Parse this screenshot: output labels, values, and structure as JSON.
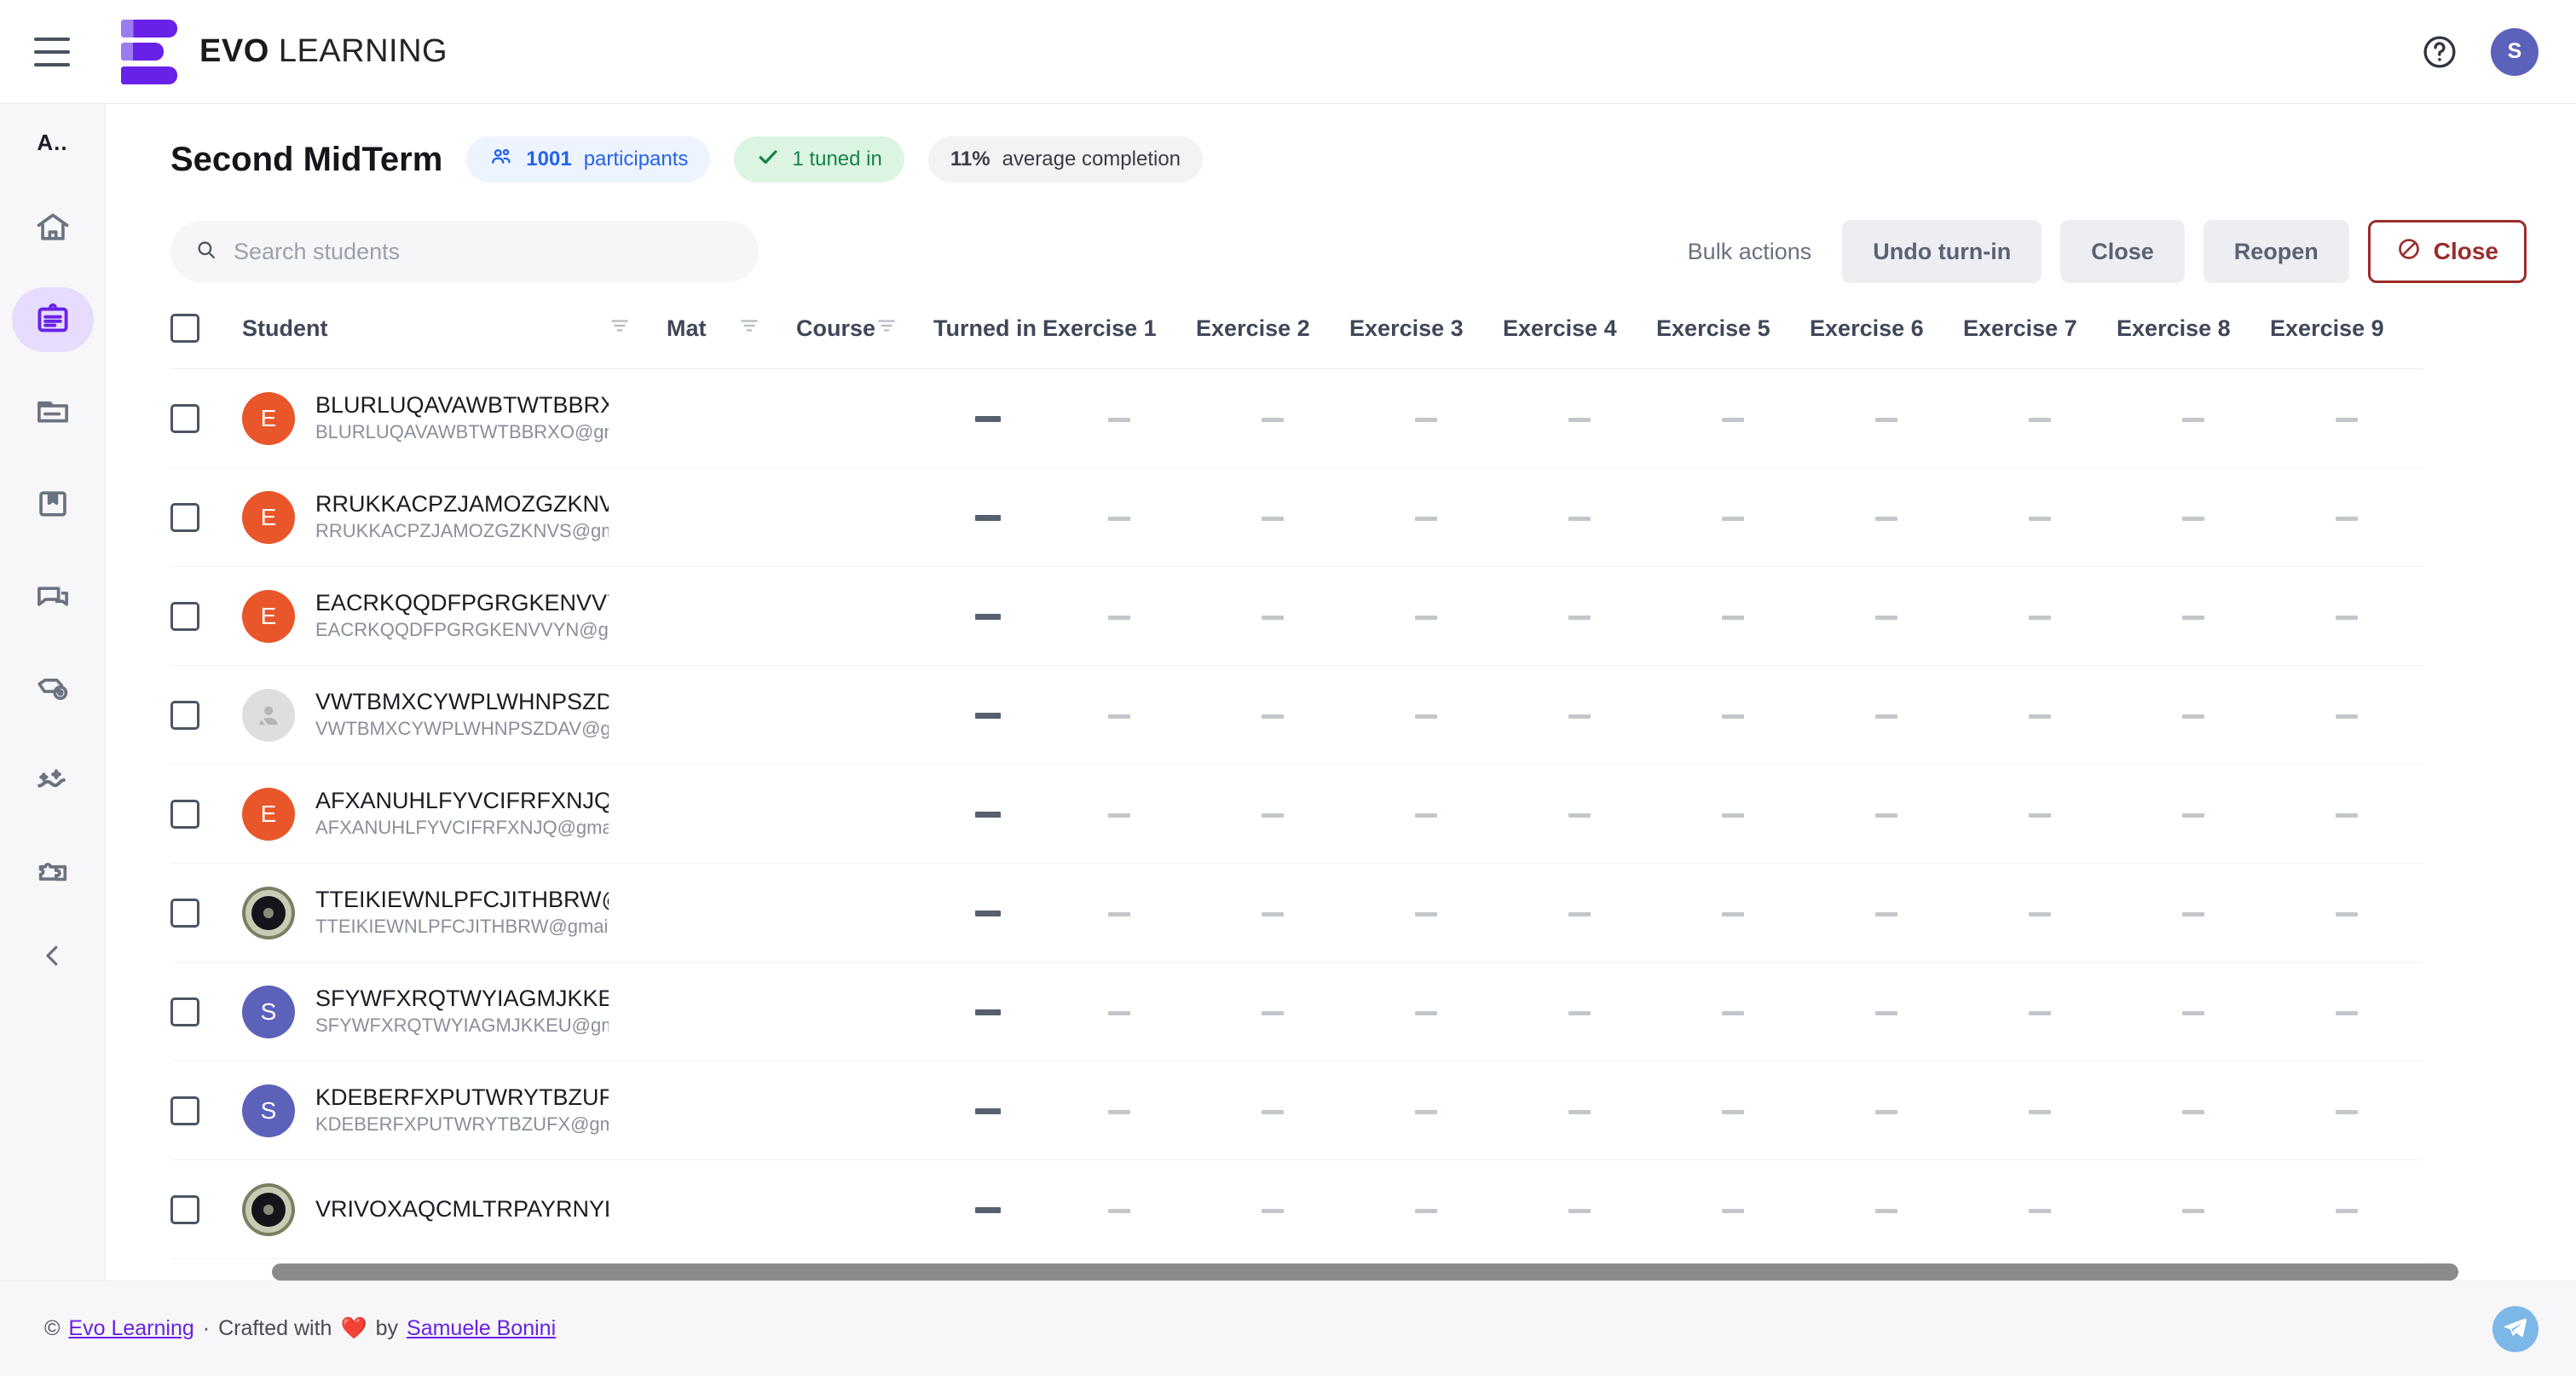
{
  "header": {
    "menu_icon": "hamburger-icon",
    "brand_bold": "EVO",
    "brand_light": "LEARNING",
    "help_icon": "help-circle-icon",
    "avatar_initial": "S"
  },
  "sidebar": {
    "label": "A..",
    "items": [
      {
        "icon": "home-icon",
        "name": "home"
      },
      {
        "icon": "clipboard-icon",
        "name": "assignments",
        "active": true
      },
      {
        "icon": "folder-icon",
        "name": "materials"
      },
      {
        "icon": "book-icon",
        "name": "library"
      },
      {
        "icon": "chat-icon",
        "name": "messages"
      },
      {
        "icon": "tag-eye-icon",
        "name": "tags"
      },
      {
        "icon": "sparkle-line-icon",
        "name": "insights"
      },
      {
        "icon": "puzzle-icon",
        "name": "integrations"
      }
    ],
    "collapse_icon": "chevron-left-icon"
  },
  "page": {
    "title": "Second MidTerm",
    "badges": {
      "participants_count": "1001",
      "participants_label": "participants",
      "participants_icon": "group-icon",
      "tuned_in": "1 tuned in",
      "tuned_in_icon": "check-icon",
      "completion_value": "11%",
      "completion_label": "average completion"
    }
  },
  "search": {
    "icon": "search-icon",
    "placeholder": "Search students",
    "value": ""
  },
  "toolbar": {
    "bulk_label": "Bulk actions",
    "undo_turn_in": "Undo turn-in",
    "close": "Close",
    "reopen": "Reopen",
    "close_danger": "Close",
    "close_danger_icon": "ban-icon"
  },
  "table": {
    "select_all_name": "select-all-checkbox",
    "columns": {
      "student": "Student",
      "mat": "Mat",
      "course": "Course",
      "turned_in": "Turned in",
      "exercises": [
        "Exercise 1",
        "Exercise 2",
        "Exercise 3",
        "Exercise 4",
        "Exercise 5",
        "Exercise 6",
        "Exercise 7",
        "Exercise 8",
        "Exercise 9"
      ]
    },
    "filter_icon": "filter-icon",
    "empty_cell": "—",
    "rows": [
      {
        "name": "BLURLUQAVAWBTWTBBRXO@g",
        "email": "BLURLUQAVAWBTWTBBRXO@gmail.",
        "avatar_type": "initial",
        "avatar_initial": "E",
        "avatar_color": "#e8562a"
      },
      {
        "name": "RRUKKACPZJAMOZGZKNVS@gn",
        "email": "RRUKKACPZJAMOZGZKNVS@gmail.c",
        "avatar_type": "initial",
        "avatar_initial": "E",
        "avatar_color": "#e8562a"
      },
      {
        "name": "EACRKQQDFPGRGKENVVYN@gr",
        "email": "EACRKQQDFPGRGKENVVYN@gmail.c",
        "avatar_type": "initial",
        "avatar_initial": "E",
        "avatar_color": "#e8562a"
      },
      {
        "name": "VWTBMXCYWPLWHNPSZDAV@g",
        "email": "VWTBMXCYWPLWHNPSZDAV@gmail.",
        "avatar_type": "none",
        "avatar_initial": "",
        "avatar_color": "#dededf"
      },
      {
        "name": "AFXANUHLFYVCIFRFXNJQ@gma",
        "email": "AFXANUHLFYVCIFRFXNJQ@gmail.cor",
        "avatar_type": "initial",
        "avatar_initial": "E",
        "avatar_color": "#e8562a"
      },
      {
        "name": "TTEIKIEWNLPFCJITHBRW@gma",
        "email": "TTEIKIEWNLPFCJITHBRW@gmail.cor",
        "avatar_type": "photo",
        "avatar_initial": "",
        "avatar_color": "#7a7f63"
      },
      {
        "name": "SFYWFXRQTWYIAGMJKKEU@gm",
        "email": "SFYWFXRQTWYIAGMJKKEU@gmail.c",
        "avatar_type": "initial",
        "avatar_initial": "S",
        "avatar_color": "#5c62ba"
      },
      {
        "name": "KDEBERFXPUTWRYTBZUFX@gm",
        "email": "KDEBERFXPUTWRYTBZUFX@gmail.c",
        "avatar_type": "initial",
        "avatar_initial": "S",
        "avatar_color": "#5c62ba"
      },
      {
        "name": "VRIVOXAQCMLTRPAYRNYL@gm",
        "email": "",
        "avatar_type": "photo",
        "avatar_initial": "",
        "avatar_color": "#7a7f63"
      }
    ]
  },
  "footer": {
    "copyright": "©",
    "brand_link": "Evo Learning",
    "separator": "·",
    "crafted_pre": "Crafted with",
    "heart": "❤️",
    "crafted_by": "by",
    "author_link": "Samuele Bonini",
    "telegram_icon": "telegram-icon"
  }
}
